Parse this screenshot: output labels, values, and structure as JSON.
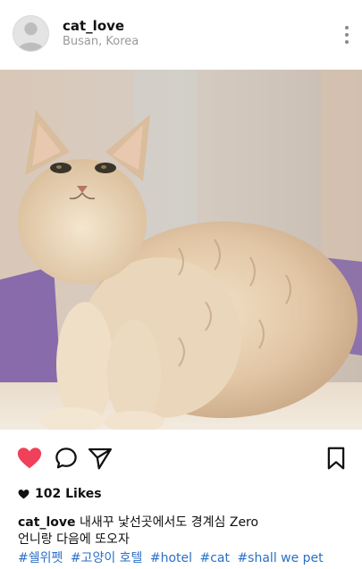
{
  "post": {
    "username": "cat_love",
    "location": "Busan, Korea",
    "likes_text": "102 Likes",
    "caption_user": "cat_love",
    "caption_line1": "내새꾸 낯선곳에서도 경계심 Zero",
    "caption_line2": "언니랑 다음에 또오자",
    "hashtags": [
      "#쉘위펫",
      "#고양이 호텔",
      "#hotel",
      "#cat",
      "#shall we pet"
    ]
  },
  "icons": {
    "avatar": "person-avatar-icon",
    "more": "more-vertical-icon",
    "like": "heart-filled-icon",
    "comment": "comment-bubble-icon",
    "share": "send-paper-plane-icon",
    "save": "bookmark-icon",
    "likes_heart": "small-heart-icon"
  },
  "colors": {
    "like_heart": "#f0405a",
    "hashtag": "#2b6fc7",
    "secondary_text": "#9a9a9a"
  }
}
